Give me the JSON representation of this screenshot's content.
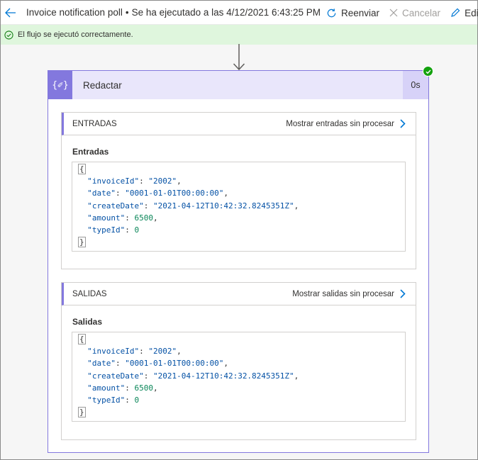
{
  "header": {
    "flow_name": "Invoice notification poll",
    "separator": "•",
    "run_status": "Se ha ejecutado a las 4/12/2021 6:43:25 PM",
    "resubmit_label": "Reenviar",
    "cancel_label": "Cancelar",
    "edit_label": "Edita"
  },
  "banner": {
    "message": "El flujo se ejecutó correctamente."
  },
  "card": {
    "icon_glyph": "{✐}",
    "title": "Redactar",
    "duration": "0s"
  },
  "inputs": {
    "header": "ENTRADAS",
    "raw_link": "Mostrar entradas sin procesar",
    "label": "Entradas",
    "json": {
      "open": "{",
      "close": "}",
      "lines": [
        {
          "key": "\"invoiceId\"",
          "value": "\"2002\"",
          "type": "s",
          "comma": ","
        },
        {
          "key": "\"date\"",
          "value": "\"0001-01-01T00:00:00\"",
          "type": "s",
          "comma": ","
        },
        {
          "key": "\"createDate\"",
          "value": "\"2021-04-12T10:42:32.8245351Z\"",
          "type": "s",
          "comma": ","
        },
        {
          "key": "\"amount\"",
          "value": "6500",
          "type": "n",
          "comma": ","
        },
        {
          "key": "\"typeId\"",
          "value": "0",
          "type": "n",
          "comma": ""
        }
      ]
    }
  },
  "outputs": {
    "header": "SALIDAS",
    "raw_link": "Mostrar salidas sin procesar",
    "label": "Salidas",
    "json": {
      "open": "{",
      "close": "}",
      "lines": [
        {
          "key": "\"invoiceId\"",
          "value": "\"2002\"",
          "type": "s",
          "comma": ","
        },
        {
          "key": "\"date\"",
          "value": "\"0001-01-01T00:00:00\"",
          "type": "s",
          "comma": ","
        },
        {
          "key": "\"createDate\"",
          "value": "\"2021-04-12T10:42:32.8245351Z\"",
          "type": "s",
          "comma": ","
        },
        {
          "key": "\"amount\"",
          "value": "6500",
          "type": "n",
          "comma": ","
        },
        {
          "key": "\"typeId\"",
          "value": "0",
          "type": "n",
          "comma": ""
        }
      ]
    }
  },
  "colors": {
    "accent": "#8378de",
    "success_bg": "#dff6dd",
    "success_icon": "#13a10e",
    "json_key": "#0451a5",
    "json_number": "#098658"
  }
}
